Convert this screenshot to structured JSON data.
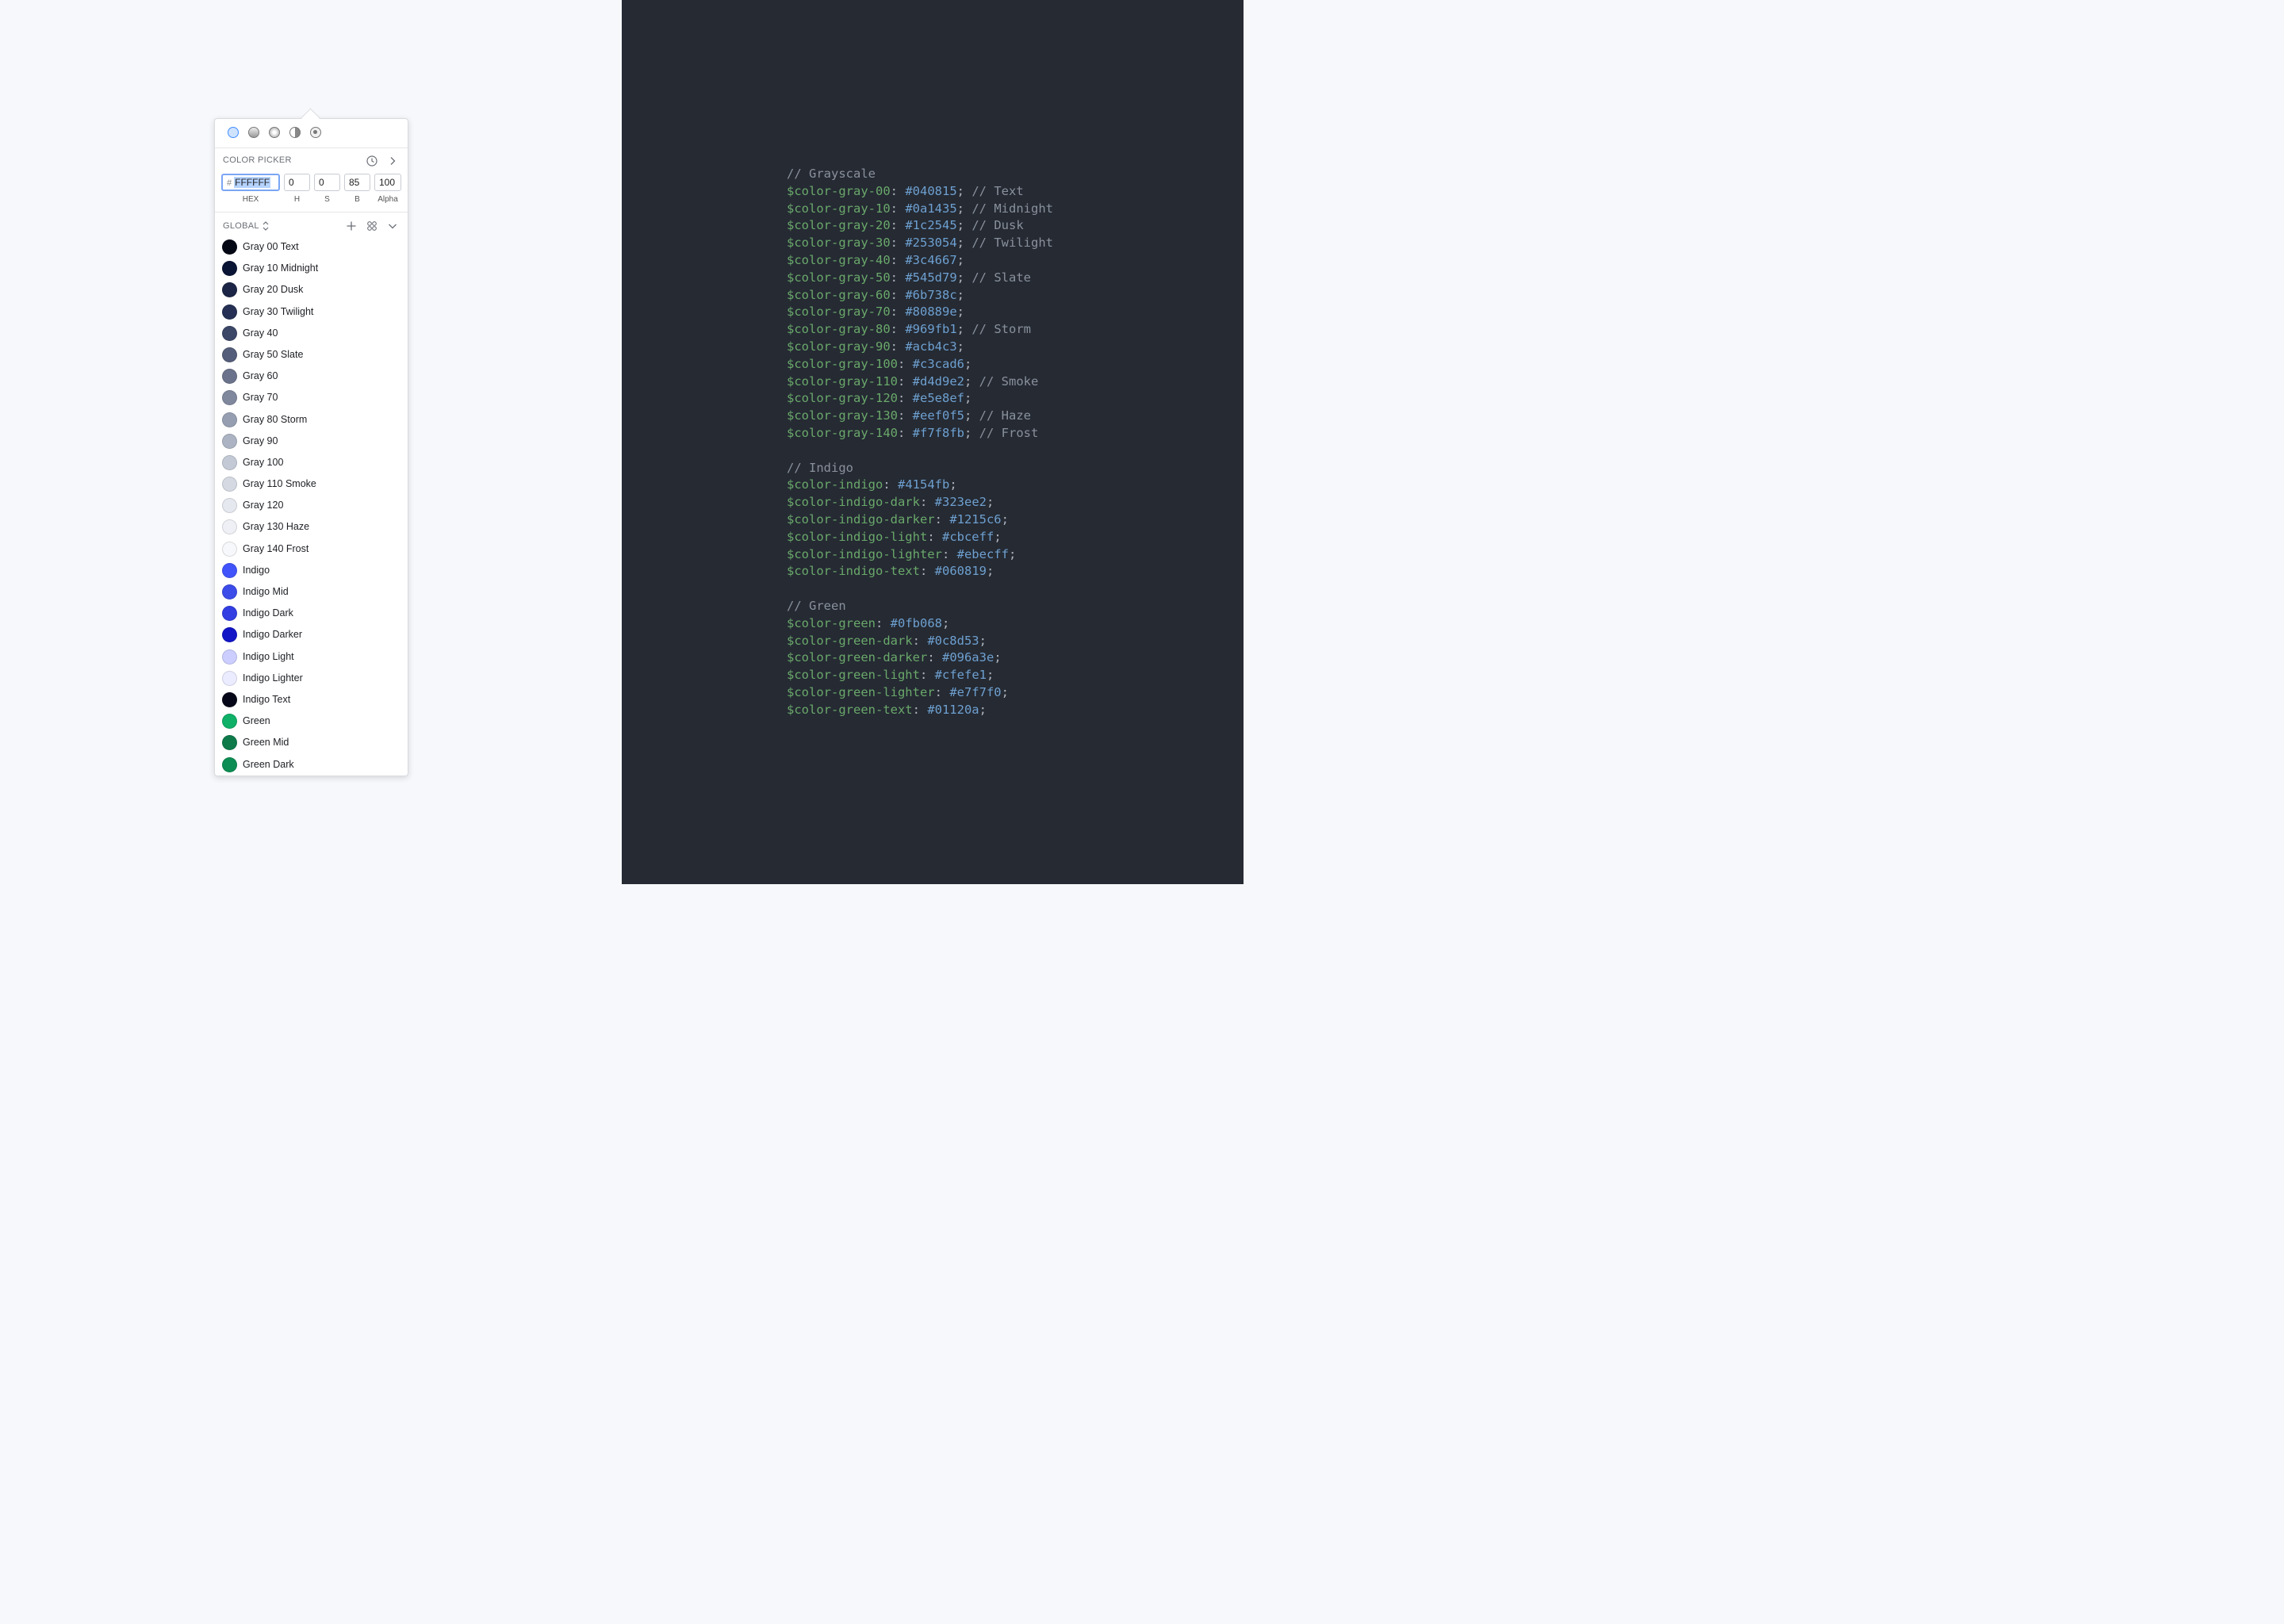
{
  "picker": {
    "modes": [
      "solid-fill-icon",
      "linear-gradient-icon",
      "radial-gradient-icon",
      "angular-gradient-icon",
      "image-fill-icon"
    ],
    "section_title": "COLOR PICKER",
    "hash": "#",
    "hex": "FFFFFF",
    "h": "0",
    "s": "0",
    "b": "85",
    "alpha": "100",
    "labels": {
      "hex": "HEX",
      "h": "H",
      "s": "S",
      "b": "B",
      "alpha": "Alpha"
    },
    "library": "GLOBAL",
    "swatches": [
      {
        "name": "Gray 00 Text",
        "color": "#040815"
      },
      {
        "name": "Gray 10 Midnight",
        "color": "#0a1435"
      },
      {
        "name": "Gray 20 Dusk",
        "color": "#1c2545"
      },
      {
        "name": "Gray 30 Twilight",
        "color": "#253054"
      },
      {
        "name": "Gray 40",
        "color": "#3c4667"
      },
      {
        "name": "Gray 50 Slate",
        "color": "#545d79"
      },
      {
        "name": "Gray 60",
        "color": "#6b738c"
      },
      {
        "name": "Gray 70",
        "color": "#80889e"
      },
      {
        "name": "Gray 80 Storm",
        "color": "#969fb1"
      },
      {
        "name": "Gray 90",
        "color": "#acb4c3"
      },
      {
        "name": "Gray 100",
        "color": "#c3cad6"
      },
      {
        "name": "Gray 110 Smoke",
        "color": "#d4d9e2"
      },
      {
        "name": "Gray 120",
        "color": "#e5e8ef"
      },
      {
        "name": "Gray 130 Haze",
        "color": "#eef0f5"
      },
      {
        "name": "Gray 140 Frost",
        "color": "#f7f8fb"
      },
      {
        "name": "Indigo",
        "color": "#4154fb"
      },
      {
        "name": "Indigo Mid",
        "color": "#3c4ce8"
      },
      {
        "name": "Indigo Dark",
        "color": "#323ee2"
      },
      {
        "name": "Indigo Darker",
        "color": "#1215c6"
      },
      {
        "name": "Indigo Light",
        "color": "#cbceff"
      },
      {
        "name": "Indigo Lighter",
        "color": "#ebecff"
      },
      {
        "name": "Indigo Text",
        "color": "#060819"
      },
      {
        "name": "Green",
        "color": "#0fb068"
      },
      {
        "name": "Green Mid",
        "color": "#0e7a4a"
      },
      {
        "name": "Green Dark",
        "color": "#0c8d53"
      }
    ]
  },
  "code": [
    {
      "comment": "// Grayscale"
    },
    {
      "var": "$color-gray-00",
      "value": "#040815",
      "note": "// Text"
    },
    {
      "var": "$color-gray-10",
      "value": "#0a1435",
      "note": "// Midnight"
    },
    {
      "var": "$color-gray-20",
      "value": "#1c2545",
      "note": "// Dusk"
    },
    {
      "var": "$color-gray-30",
      "value": "#253054",
      "note": "// Twilight"
    },
    {
      "var": "$color-gray-40",
      "value": "#3c4667",
      "note": ""
    },
    {
      "var": "$color-gray-50",
      "value": "#545d79",
      "note": "// Slate"
    },
    {
      "var": "$color-gray-60",
      "value": "#6b738c",
      "note": ""
    },
    {
      "var": "$color-gray-70",
      "value": "#80889e",
      "note": ""
    },
    {
      "var": "$color-gray-80",
      "value": "#969fb1",
      "note": "// Storm"
    },
    {
      "var": "$color-gray-90",
      "value": "#acb4c3",
      "note": ""
    },
    {
      "var": "$color-gray-100",
      "value": "#c3cad6",
      "note": ""
    },
    {
      "var": "$color-gray-110",
      "value": "#d4d9e2",
      "note": "// Smoke"
    },
    {
      "var": "$color-gray-120",
      "value": "#e5e8ef",
      "note": ""
    },
    {
      "var": "$color-gray-130",
      "value": "#eef0f5",
      "note": "// Haze"
    },
    {
      "var": "$color-gray-140",
      "value": "#f7f8fb",
      "note": "// Frost"
    },
    {
      "blank": true
    },
    {
      "comment": "// Indigo"
    },
    {
      "var": "$color-indigo",
      "value": "#4154fb",
      "note": ""
    },
    {
      "var": "$color-indigo-dark",
      "value": "#323ee2",
      "note": ""
    },
    {
      "var": "$color-indigo-darker",
      "value": "#1215c6",
      "note": ""
    },
    {
      "var": "$color-indigo-light",
      "value": "#cbceff",
      "note": ""
    },
    {
      "var": "$color-indigo-lighter",
      "value": "#ebecff",
      "note": ""
    },
    {
      "var": "$color-indigo-text",
      "value": "#060819",
      "note": ""
    },
    {
      "blank": true
    },
    {
      "comment": "// Green"
    },
    {
      "var": "$color-green",
      "value": "#0fb068",
      "note": ""
    },
    {
      "var": "$color-green-dark",
      "value": "#0c8d53",
      "note": ""
    },
    {
      "var": "$color-green-darker",
      "value": "#096a3e",
      "note": ""
    },
    {
      "var": "$color-green-light",
      "value": "#cfefe1",
      "note": ""
    },
    {
      "var": "$color-green-lighter",
      "value": "#e7f7f0",
      "note": ""
    },
    {
      "var": "$color-green-text",
      "value": "#01120a",
      "note": ""
    }
  ]
}
